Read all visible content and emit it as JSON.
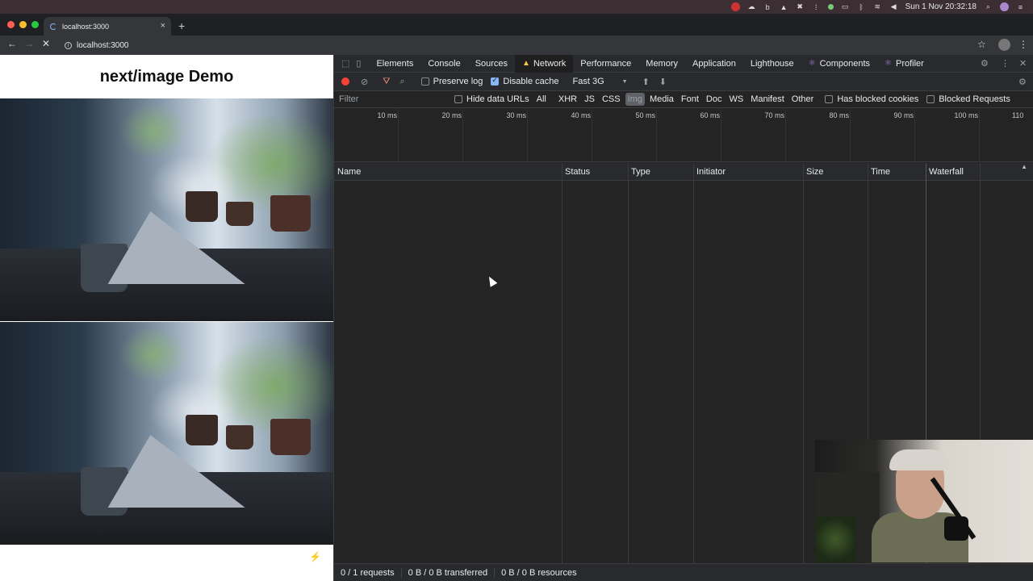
{
  "menubar": {
    "clock": "Sun 1 Nov  20:32:18",
    "icons": [
      "lastpass-icon",
      "cloud-icon",
      "b-icon",
      "docker-icon",
      "x-icon",
      "dots-icon",
      "status-dot-icon",
      "airplay-icon",
      "bluetooth-icon",
      "wifi-icon",
      "volume-icon",
      "search-icon",
      "siri-icon",
      "control-icon"
    ]
  },
  "browser": {
    "tab_title": "localhost:3000",
    "tab_close": "×",
    "new_tab": "+",
    "url": "localhost:3000",
    "back": "←",
    "forward": "→",
    "stop": "✕",
    "bookmark": "☆",
    "menu": "⋮"
  },
  "page": {
    "title": "next/image Demo",
    "vercel_badge": "⚡"
  },
  "devtools": {
    "tabs": [
      {
        "label": "Elements"
      },
      {
        "label": "Console"
      },
      {
        "label": "Sources"
      },
      {
        "label": "Network"
      },
      {
        "label": "Performance"
      },
      {
        "label": "Memory"
      },
      {
        "label": "Application"
      },
      {
        "label": "Lighthouse"
      },
      {
        "label": "Components"
      },
      {
        "label": "Profiler"
      }
    ],
    "toolbar": {
      "preserve_log": "Preserve log",
      "disable_cache": "Disable cache",
      "throttle": "Fast 3G",
      "throttle_arrow": "▼",
      "upload": "⬆",
      "download": "⬇"
    },
    "filter": {
      "placeholder": "Filter",
      "hide_data_urls": "Hide data URLs",
      "types": [
        "All",
        "XHR",
        "JS",
        "CSS",
        "Img",
        "Media",
        "Font",
        "Doc",
        "WS",
        "Manifest",
        "Other"
      ],
      "selected_type": "Img",
      "has_blocked_cookies": "Has blocked cookies",
      "blocked_requests": "Blocked Requests"
    },
    "timeline_ticks": [
      "10 ms",
      "20 ms",
      "30 ms",
      "40 ms",
      "50 ms",
      "60 ms",
      "70 ms",
      "80 ms",
      "90 ms",
      "100 ms",
      "110"
    ],
    "columns": [
      "Name",
      "Status",
      "Type",
      "Initiator",
      "Size",
      "Time",
      "Waterfall"
    ],
    "sort_indicator": "▲",
    "status": {
      "requests": "0 / 1 requests",
      "transferred": "0 B / 0 B transferred",
      "resources": "0 B / 0 B resources"
    }
  }
}
